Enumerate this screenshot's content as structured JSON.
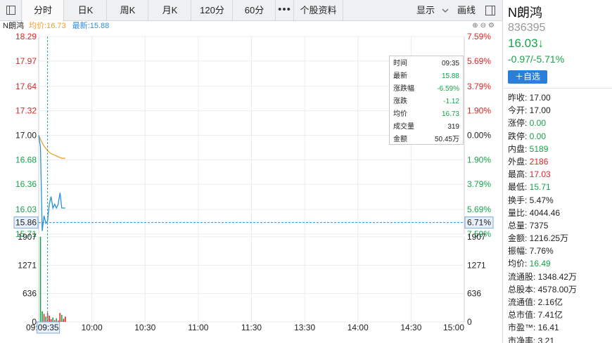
{
  "toolbar": {
    "tabs": [
      "分时",
      "日K",
      "周K",
      "月K",
      "120分",
      "60分"
    ],
    "more_label": "•••",
    "profile_label": "个股资料",
    "display_label": "显示",
    "draw_label": "画线"
  },
  "chart": {
    "legend_name": "N朗鸿",
    "legend_avg": "均价:16.73",
    "legend_last": "最新:15.88",
    "price_ticks": [
      "18.29",
      "17.97",
      "17.64",
      "17.32",
      "17.00",
      "16.68",
      "16.36",
      "16.03",
      "15.71"
    ],
    "pct_ticks": [
      "7.59%",
      "5.69%",
      "3.79%",
      "1.90%",
      "0.00%",
      "1.90%",
      "3.79%",
      "5.69%",
      "7.59%"
    ],
    "vol_ticks": [
      "1907",
      "1271",
      "636",
      "0"
    ],
    "time_ticks": [
      "09:30",
      "10:00",
      "10:30",
      "11:00",
      "11:30",
      "13:30",
      "14:00",
      "14:30",
      "15:00"
    ],
    "crosshair_price": "15.86",
    "crosshair_pct": "6.71%",
    "crosshair_time": "09:35",
    "colors": {
      "price_line": "#2a8fdc",
      "avg_line": "#f0a030",
      "up": "#e02424",
      "down": "#16a34a"
    }
  },
  "chart_data": {
    "type": "line",
    "title": "",
    "x": [
      "09:30",
      "09:31",
      "09:32",
      "09:33",
      "09:34",
      "09:35",
      "09:36",
      "09:37",
      "09:38",
      "09:39",
      "09:40",
      "09:41",
      "09:42",
      "09:43",
      "09:44",
      "09:45"
    ],
    "series": [
      {
        "name": "最新",
        "values": [
          17.0,
          16.85,
          15.75,
          15.95,
          15.85,
          15.88,
          16.1,
          16.2,
          16.05,
          16.1,
          16.05,
          16.1,
          16.25,
          16.05,
          16.05,
          16.05
        ]
      },
      {
        "name": "均价",
        "values": [
          17.0,
          16.95,
          16.9,
          16.86,
          16.83,
          16.8,
          16.78,
          16.76,
          16.75,
          16.74,
          16.73,
          16.72,
          16.71,
          16.7,
          16.7,
          16.7
        ]
      }
    ],
    "volume": [
      0,
      1910,
      240,
      180,
      120,
      200,
      140,
      60,
      100,
      40,
      80,
      30,
      200,
      160,
      70,
      120
    ],
    "ylim": [
      15.71,
      18.29
    ],
    "vol_ylim": [
      0,
      1907
    ],
    "prev_close": 17.0
  },
  "popup": {
    "rows": [
      {
        "k": "时间",
        "v": "09:35",
        "c": ""
      },
      {
        "k": "最新",
        "v": "15.88",
        "c": "green"
      },
      {
        "k": "涨跌幅",
        "v": "-6.59%",
        "c": "green"
      },
      {
        "k": "涨跌",
        "v": "-1.12",
        "c": "green"
      },
      {
        "k": "均价",
        "v": "16.73",
        "c": "green"
      },
      {
        "k": "成交量",
        "v": "319",
        "c": ""
      },
      {
        "k": "金额",
        "v": "50.45万",
        "c": ""
      }
    ]
  },
  "sidebar": {
    "name": "N朗鸿",
    "code": "836395",
    "price": "16.03↓",
    "change": "-0.97/-5.71%",
    "add_label": "＋自选",
    "rows": [
      {
        "k": "昨收:",
        "v": "17.00",
        "c": ""
      },
      {
        "k": "今开:",
        "v": "17.00",
        "c": ""
      },
      {
        "k": "涨停:",
        "v": "0.00",
        "c": "green"
      },
      {
        "k": "跌停:",
        "v": "0.00",
        "c": "green"
      },
      {
        "k": "内盘:",
        "v": "5189",
        "c": "green"
      },
      {
        "k": "外盘:",
        "v": "2186",
        "c": "red"
      },
      {
        "k": "最高:",
        "v": "17.03",
        "c": "red"
      },
      {
        "k": "最低:",
        "v": "15.71",
        "c": "green"
      },
      {
        "k": "换手:",
        "v": "5.47%",
        "c": ""
      },
      {
        "k": "量比:",
        "v": "4044.46",
        "c": ""
      },
      {
        "k": "总量:",
        "v": "7375",
        "c": ""
      },
      {
        "k": "金额:",
        "v": "1216.25万",
        "c": ""
      },
      {
        "k": "振幅:",
        "v": "7.76%",
        "c": ""
      },
      {
        "k": "均价:",
        "v": "16.49",
        "c": "green"
      },
      {
        "k": "流通股:",
        "v": "1348.42万",
        "c": ""
      },
      {
        "k": "总股本:",
        "v": "4578.00万",
        "c": ""
      },
      {
        "k": "流通值:",
        "v": "2.16亿",
        "c": ""
      },
      {
        "k": "总市值:",
        "v": "7.41亿",
        "c": ""
      },
      {
        "k": "市盈™:",
        "v": "16.41",
        "c": ""
      },
      {
        "k": "市净率:",
        "v": "3.21",
        "c": ""
      }
    ]
  }
}
